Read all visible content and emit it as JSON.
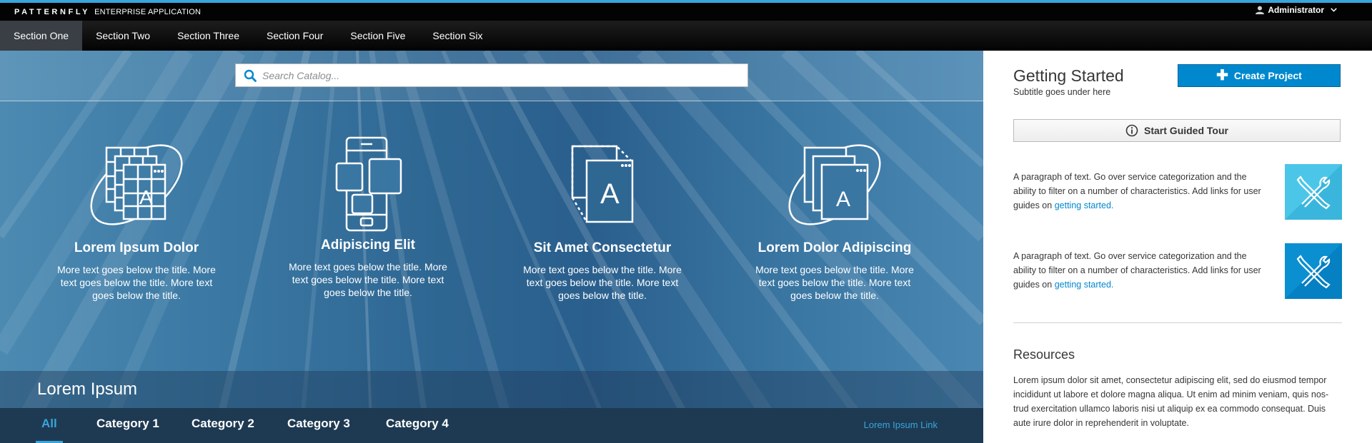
{
  "masthead": {
    "brand": "PATTERNFLY",
    "brand_sub": "ENTERPRISE APPLICATION",
    "user": "Administrator",
    "accent_color": "#39a5dc"
  },
  "nav": {
    "items": [
      {
        "label": "Section One",
        "active": true
      },
      {
        "label": "Section Two"
      },
      {
        "label": "Section Three"
      },
      {
        "label": "Section Four"
      },
      {
        "label": "Section Five"
      },
      {
        "label": "Section Six"
      }
    ]
  },
  "search": {
    "placeholder": "Search Catalog..."
  },
  "features": [
    {
      "icon": "table-orbit-icon",
      "title": "Lorem Ipsum Dolor",
      "desc": "More text goes below the title. More text goes below the title. More text goes below the title."
    },
    {
      "icon": "mobile-devices-icon",
      "title": "Adipiscing Elit",
      "desc": "More text goes below the title. More text goes below the title. More text goes below the title."
    },
    {
      "icon": "app-cube-icon",
      "title": "Sit Amet Consectetur",
      "desc": "More text goes below the title. More text goes below the title. More text goes below the title."
    },
    {
      "icon": "stacked-windows-orbit-icon",
      "title": "Lorem Dolor Adipiscing",
      "desc": "More text goes below the title. More text goes below the title. More text goes below the title."
    }
  ],
  "band": {
    "title": "Lorem Ipsum"
  },
  "categories": {
    "tabs": [
      {
        "label": "All",
        "active": true
      },
      {
        "label": "Category 1"
      },
      {
        "label": "Category 2"
      },
      {
        "label": "Category 3"
      },
      {
        "label": "Category 4"
      }
    ],
    "link": "Lorem Ipsum Link"
  },
  "sidebar": {
    "title": "Getting Started",
    "subtitle": "Subtitle goes under here",
    "create_button": "Create Project",
    "tour_button": "Start Guided Tour",
    "info": [
      {
        "text": "A paragraph of text. Go over service categorization and the ability to filter on a number of characteristics. Add links for user guides on ",
        "link": "getting started.",
        "icon": "tools-icon",
        "color": "#4cc6e8"
      },
      {
        "text": "A paragraph of text. Go over service categorization and the ability to filter on a number of characteristics. Add links for user guides on ",
        "link": "getting started.",
        "icon": "tools-icon",
        "color": "#0a8fd1"
      }
    ],
    "resources_title": "Resources",
    "resources_text": "Lorem ipsum dolor sit amet, consectetur adipiscing elit, sed do eiusmod tempor incididunt ut labore et dolore magna aliqua. Ut enim ad minim veniam, quis nos-trud exercitation ullamco laboris nisi ut aliquip ex ea commodo consequat. Duis aute irure dolor in reprehenderit in voluptate."
  }
}
